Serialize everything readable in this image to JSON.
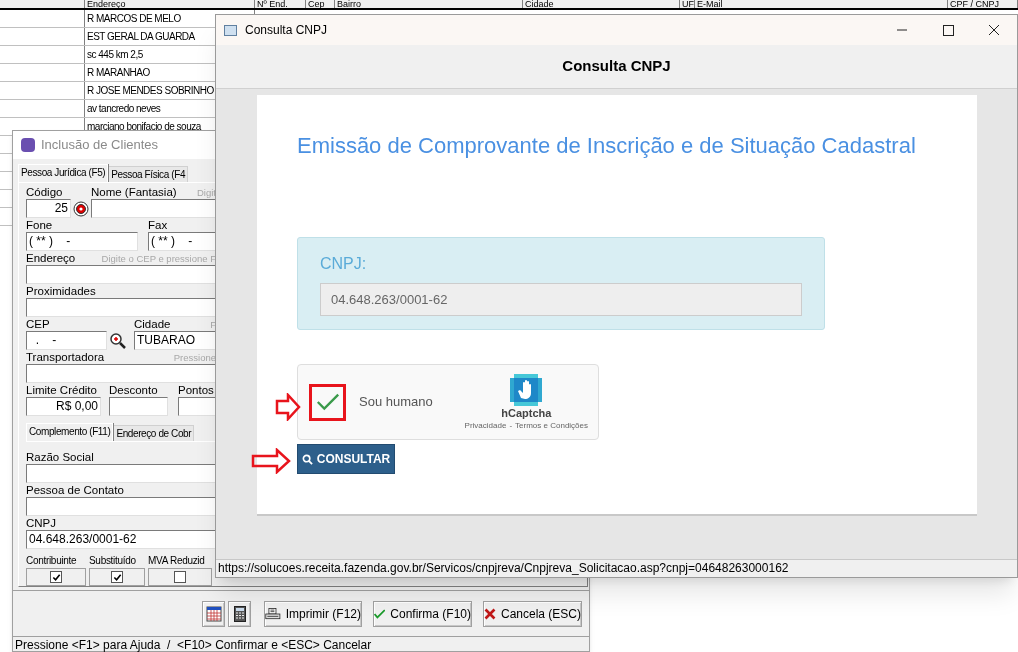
{
  "background_table": {
    "columns": [
      "",
      "Endereço",
      "Nº End.",
      "Cep",
      "Bairro",
      "Cidade",
      "UF",
      "E-Mail",
      "CPF / CNPJ"
    ],
    "rows": [
      "R MARCOS DE MELO",
      "EST GERAL DA GUARDA",
      "sc 445 km 2,5",
      "R MARANHAO",
      "R JOSE MENDES SOBRINHO",
      "av tancredo neves",
      "marciano bonifacio de souza"
    ]
  },
  "client_form": {
    "title": "Inclusão de Clientes",
    "tabs": [
      {
        "label": "Pessoa Jurídica (F5)",
        "selected": true
      },
      {
        "label": "Pessoa Física (F4",
        "selected": false
      }
    ],
    "rows": [
      [
        {
          "kind": "code",
          "label": "Código",
          "value": "25"
        },
        {
          "kind": "text",
          "label": "Nome  (Fantasia)",
          "hint": "Digit"
        }
      ],
      [
        {
          "kind": "text",
          "label": "Fone",
          "value": "( ** )    -"
        },
        {
          "kind": "text",
          "label": "Fax",
          "value": "( ** )    -"
        }
      ],
      [
        {
          "kind": "text",
          "label": "Endereço",
          "hint": "Digite o CEP e pressione F"
        }
      ],
      [
        {
          "kind": "text",
          "label": "Proximidades"
        }
      ],
      [
        {
          "kind": "search",
          "label": "CEP",
          "value": "  .    -"
        },
        {
          "kind": "text",
          "label": "Cidade",
          "hint": "F",
          "value": "TUBARAO"
        }
      ],
      [
        {
          "kind": "text",
          "label": "Transportadora",
          "hint": "Pressione"
        }
      ],
      [
        {
          "kind": "money",
          "label": "Limite Crédito",
          "value": "R$ 0,00"
        },
        {
          "kind": "text",
          "label": "Desconto"
        },
        {
          "kind": "text",
          "label": "Pontos"
        }
      ]
    ],
    "sub_tabs": [
      {
        "label": "Complemento (F11)",
        "selected": true
      },
      {
        "label": "Endereço de Cobr",
        "selected": false
      }
    ],
    "sub_rows": [
      [
        {
          "kind": "text",
          "label": "Razão Social"
        }
      ],
      [
        {
          "kind": "text",
          "label": "Pessoa de Contato"
        }
      ],
      [
        {
          "kind": "text",
          "label": "CNPJ",
          "value": "04.648.263/0001-62"
        }
      ]
    ],
    "checkboxes": [
      {
        "label": "Contribuinte",
        "checked": true
      },
      {
        "label": "Substituído",
        "checked": true
      },
      {
        "label": "MVA Reduzid",
        "checked": false
      }
    ],
    "buttons": [
      {
        "kind": "calendar"
      },
      {
        "kind": "calculator"
      },
      {
        "kind": "print",
        "label": "Imprimir (F12)"
      },
      {
        "kind": "confirm",
        "label": "Confirma (F10)"
      },
      {
        "kind": "cancel",
        "label": "Cancela (ESC)"
      }
    ],
    "status_bar": "Pressione <F1> para Ajuda  /  <F10> Confirmar e <ESC> Cancelar"
  },
  "consulta_window": {
    "title": "Consulta CNPJ",
    "header": "Consulta CNPJ",
    "heading": "Emissão de Comprovante de Inscrição e de Situação Cadastral",
    "cnpj_label": "CNPJ:",
    "cnpj_value": "04.648.263/0001-62",
    "captcha": {
      "checked": true,
      "label": "Sou humano",
      "brand": "hCaptcha",
      "links": [
        "Privacidade",
        "Termos e Condições"
      ],
      "separator": "-"
    },
    "button": "CONSULTAR",
    "status_url": "https://solucoes.receita.fazenda.gov.br/Servicos/cnpjreva/Cnpjreva_Solicitacao.asp?cnpj=04648263000162"
  }
}
